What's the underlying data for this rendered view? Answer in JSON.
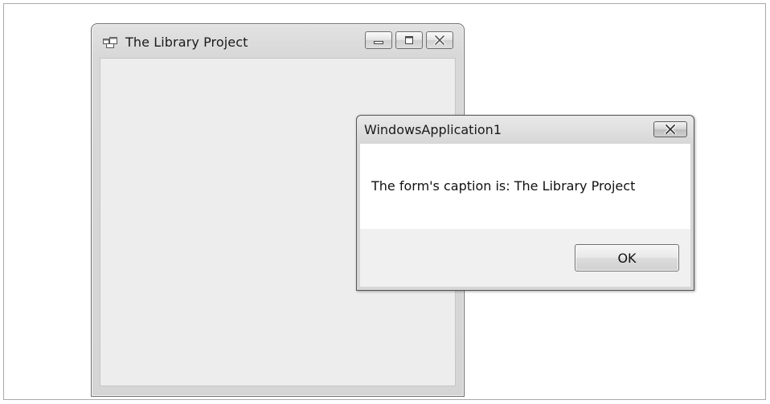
{
  "form_window": {
    "title": "The Library Project",
    "icon": "app-form-icon",
    "caption_buttons": [
      "minimize-icon",
      "maximize-icon",
      "close-icon"
    ]
  },
  "message_box": {
    "title": "WindowsApplication1",
    "text": "The form's caption is: The Library Project",
    "ok_label": "OK",
    "close_icon": "close-icon"
  }
}
